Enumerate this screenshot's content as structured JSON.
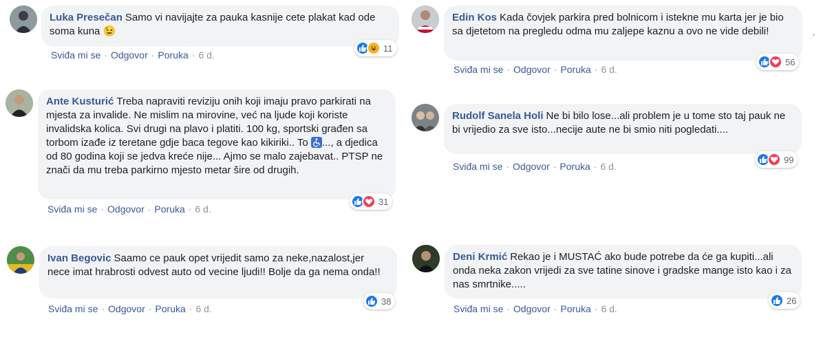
{
  "actions": {
    "like": "Sviđa mi se",
    "reply": "Odgovor",
    "message": "Poruka",
    "sep": "·"
  },
  "comments": [
    {
      "author": "Luka Presečan",
      "text": "Samo vi navijajte za pauka kasnije cete plakat kad ode soma kuna ",
      "emoji": "😉",
      "time": "6 d.",
      "reactions": [
        "like",
        "haha"
      ],
      "count": "11"
    },
    {
      "author": "Edin Kos",
      "text": "Kada čovjek parkira pred bolnicom i istekne mu karta jer je bio sa djetetom na pregledu odma mu zaljepe kaznu a ovo ne vide debili!",
      "time": "6 d.",
      "reactions": [
        "like",
        "love"
      ],
      "count": "56"
    },
    {
      "author": "Ante Kusturić",
      "text_a": "Treba napraviti reviziju onih koji imaju pravo parkirati na mjesta za invalide. Ne mislim na mirovine, već na ljude koji koriste invalidska kolica. Svi drugi na plavo i platiti. 100 kg, sportski građen sa torbom izađe iz teretane gdje baca tegove kao kikiriki.. To ",
      "text_b": "..., a djedica od 80 godina koji se jedva kreće nije... Ajmo se malo zajebavat.. PTSP ne znači da mu treba parkirno mjesto metar šire od drugih.",
      "time": "6 d.",
      "reactions": [
        "like",
        "love"
      ],
      "count": "31"
    },
    {
      "author": "Rudolf Sanela Holi",
      "text": "Ne bi bilo lose...ali problem je u tome sto taj pauk ne bi vrijedio za sve isto...necije aute ne bi smio niti pogledati....",
      "time": "6 d.",
      "reactions": [
        "like",
        "love"
      ],
      "count": "99"
    },
    {
      "author": "Ivan Begovic",
      "text": "Saamo ce pauk opet vrijedit samo za neke,nazalost,jer nece imat hrabrosti odvest auto od vecine ljudi!! Bolje da ga nema onda!!",
      "time": "6 d.",
      "reactions": [
        "like"
      ],
      "count": "38"
    },
    {
      "author": "Deni Krmić",
      "text": "Rekao je i MUSTAĆ ako bude potrebe da će ga kupiti...ali onda neka zakon vrijedi za sve tatine sinove i gradske mange isto kao i za nas smrtnike.....",
      "time": "6 d.",
      "reactions": [
        "like"
      ],
      "count": "26"
    }
  ]
}
